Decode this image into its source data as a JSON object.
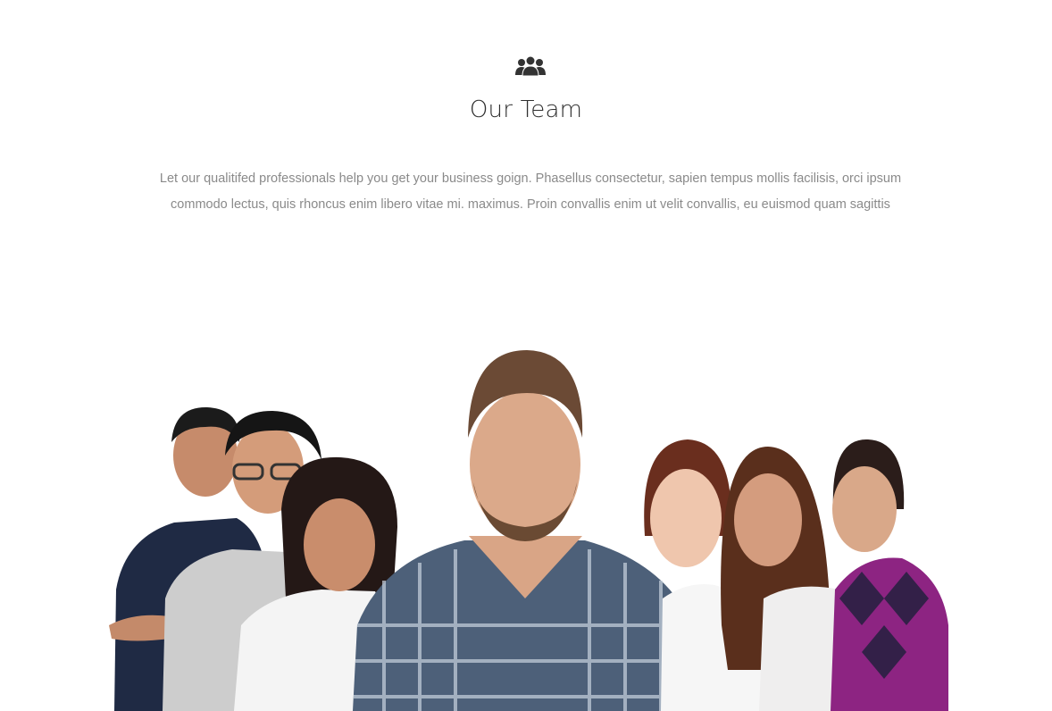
{
  "section": {
    "icon": "team-icon",
    "title": "Our Team",
    "description": "Let our qualitifed professionals help you get your business goign. Phasellus consectetur, sapien tempus mollis facilisis, orci ipsum commodo lectus, quis rhoncus enim libero vitae mi. maximus. Proin convallis enim ut velit convallis, eu euismod quam sagittis"
  },
  "colors": {
    "background": "#ffffff",
    "title": "#2f2f2f",
    "text": "#8a8a8a",
    "icon": "#333333"
  }
}
